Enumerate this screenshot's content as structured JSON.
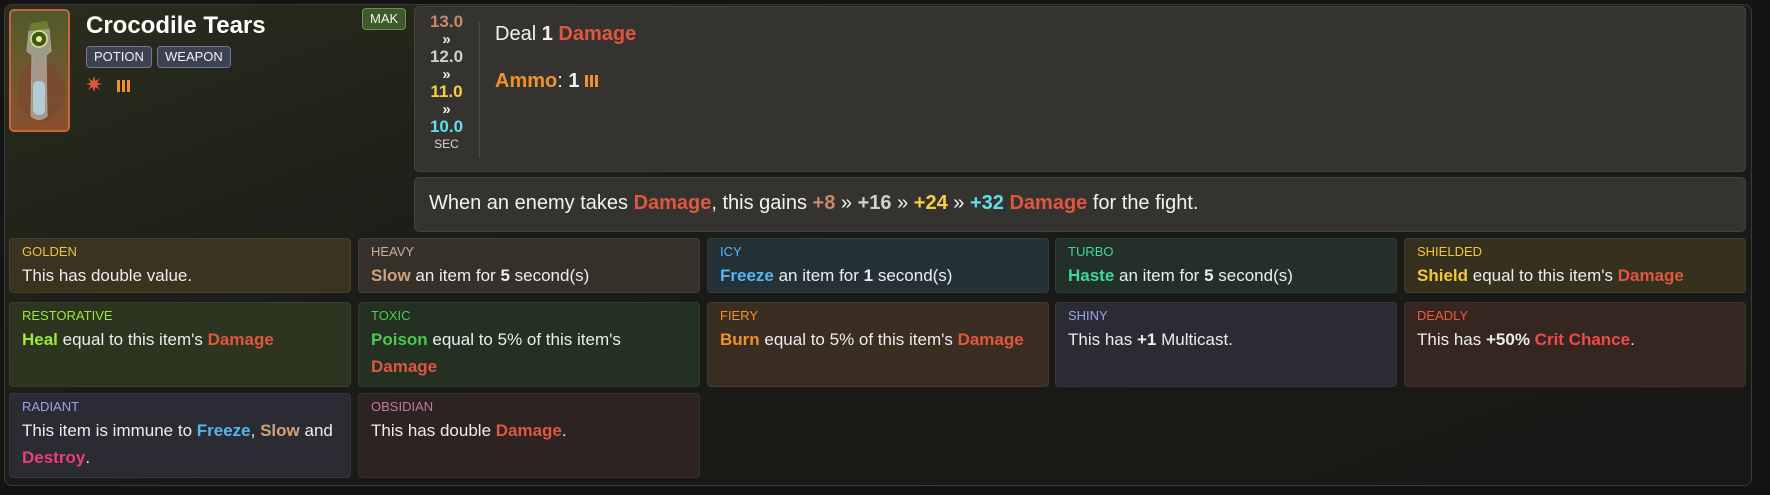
{
  "item": {
    "title": "Crocodile Tears",
    "tags": [
      "POTION",
      "WEAPON"
    ],
    "owner_badge": "MAK",
    "icons": [
      "burst-icon",
      "ammo-icon"
    ]
  },
  "cooldown": {
    "tiers": [
      "13.0",
      "12.0",
      "11.0",
      "10.0"
    ],
    "separator": "»",
    "unit": "SEC"
  },
  "ability": {
    "deal_prefix": "Deal",
    "deal_value": "1",
    "deal_keyword": "Damage",
    "ammo_label": "Ammo",
    "ammo_colon": ":",
    "ammo_value": "1"
  },
  "passive": {
    "prefix": "When an enemy takes",
    "keyword": "Damage",
    "middle": ", this gains",
    "tiers": [
      "+8",
      "+16",
      "+24",
      "+32"
    ],
    "separator": "»",
    "stat": "Damage",
    "suffix": "for the fight."
  },
  "enchantments": [
    {
      "name": "GOLDEN",
      "parts": [
        {
          "t": "This has double value."
        }
      ]
    },
    {
      "name": "HEAVY",
      "parts": [
        {
          "t": "Slow",
          "c": "slow"
        },
        {
          "t": " an item for "
        },
        {
          "t": "5",
          "c": "b"
        },
        {
          "t": " second(s)"
        }
      ]
    },
    {
      "name": "ICY",
      "parts": [
        {
          "t": "Freeze",
          "c": "freeze"
        },
        {
          "t": " an item for "
        },
        {
          "t": "1",
          "c": "b"
        },
        {
          "t": " second(s)"
        }
      ]
    },
    {
      "name": "TURBO",
      "parts": [
        {
          "t": "Haste",
          "c": "haste"
        },
        {
          "t": " an item for "
        },
        {
          "t": "5",
          "c": "b"
        },
        {
          "t": " second(s)"
        }
      ]
    },
    {
      "name": "SHIELDED",
      "parts": [
        {
          "t": "Shield",
          "c": "shield"
        },
        {
          "t": " equal to this item's "
        },
        {
          "t": "Damage",
          "c": "dmg"
        }
      ]
    },
    {
      "name": "RESTORATIVE",
      "parts": [
        {
          "t": "Heal",
          "c": "heal"
        },
        {
          "t": " equal to this item's "
        },
        {
          "t": "Damage",
          "c": "dmg"
        }
      ]
    },
    {
      "name": "TOXIC",
      "parts": [
        {
          "t": "Poison",
          "c": "poison"
        },
        {
          "t": " equal to 5% of this item's "
        },
        {
          "t": "Damage",
          "c": "dmg"
        }
      ]
    },
    {
      "name": "FIERY",
      "parts": [
        {
          "t": "Burn",
          "c": "burn"
        },
        {
          "t": " equal to 5% of this item's "
        },
        {
          "t": "Damage",
          "c": "dmg"
        }
      ]
    },
    {
      "name": "SHINY",
      "parts": [
        {
          "t": "This has "
        },
        {
          "t": "+1",
          "c": "b"
        },
        {
          "t": " Multicast."
        }
      ]
    },
    {
      "name": "DEADLY",
      "parts": [
        {
          "t": "This has "
        },
        {
          "t": "+50%",
          "c": "b"
        },
        {
          "t": " "
        },
        {
          "t": "Crit Chance",
          "c": "crit"
        },
        {
          "t": "."
        }
      ]
    },
    {
      "name": "RADIANT",
      "parts": [
        {
          "t": "This item is immune to "
        },
        {
          "t": "Freeze",
          "c": "freeze"
        },
        {
          "t": ", "
        },
        {
          "t": "Slow",
          "c": "slow"
        },
        {
          "t": " and "
        },
        {
          "t": "Destroy",
          "c": "destroy"
        },
        {
          "t": "."
        }
      ]
    },
    {
      "name": "OBSIDIAN",
      "parts": [
        {
          "t": "This has double "
        },
        {
          "t": "Damage",
          "c": "dmg"
        },
        {
          "t": "."
        }
      ]
    }
  ],
  "colors": {
    "damage": "#e0573f",
    "ammo": "#f0922a",
    "tier_bronze": "#c58a6a",
    "tier_silver": "#d0d0d0",
    "tier_gold": "#f5d142",
    "tier_diamond": "#5fe0ee"
  }
}
